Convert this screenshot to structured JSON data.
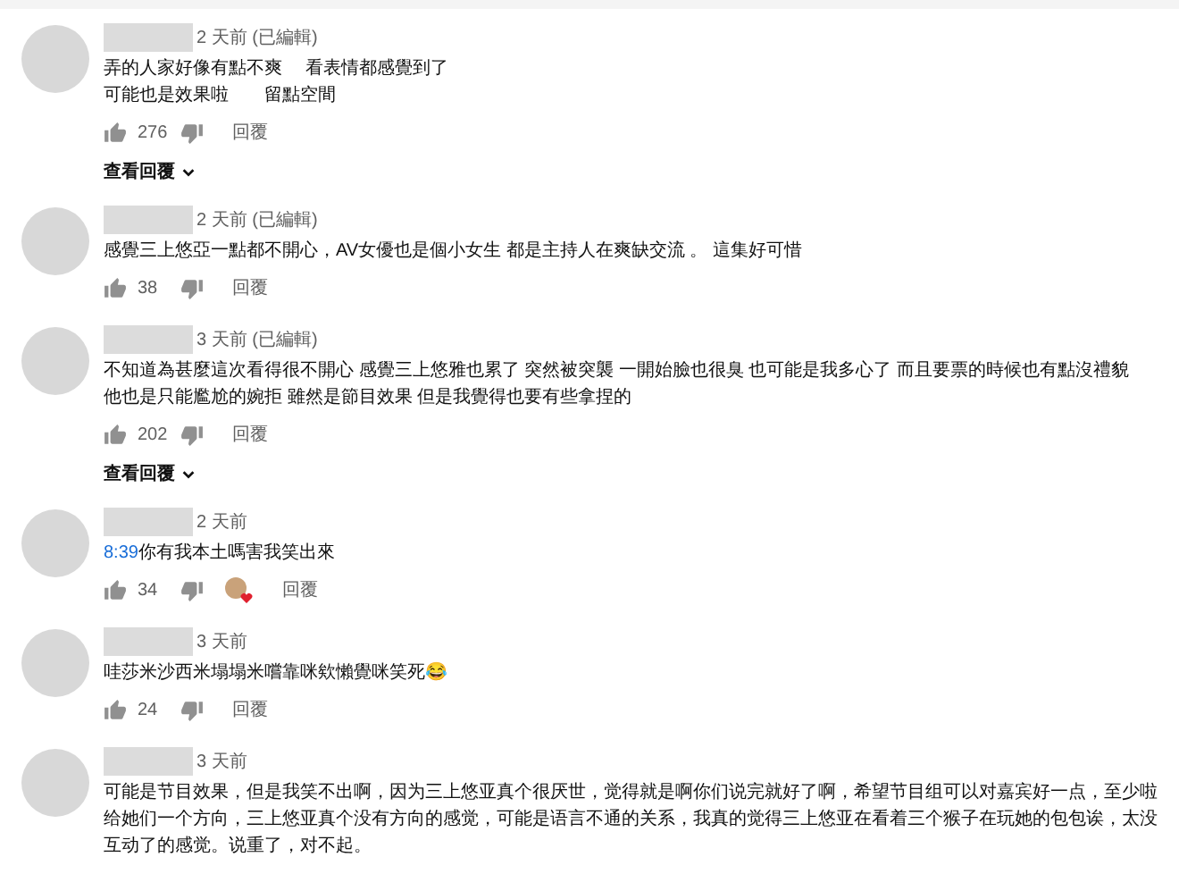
{
  "comments": [
    {
      "time": "2 天前 (已編輯)",
      "lines": [
        {
          "text": "弄的人家好像有點不爽　 看表情都感覺到了"
        },
        {
          "text": "可能也是效果啦　　留點空間"
        }
      ],
      "likes": "276",
      "hearted": false,
      "reply": "回覆",
      "view_replies": "查看回覆"
    },
    {
      "time": "2 天前 (已編輯)",
      "lines": [
        {
          "text": "感覺三上悠亞一點都不開心，AV女優也是個小女生 都是主持人在爽缺交流 。 這集好可惜"
        }
      ],
      "likes": "38",
      "hearted": false,
      "reply": "回覆"
    },
    {
      "time": "3 天前 (已編輯)",
      "lines": [
        {
          "text": "不知道為甚麼這次看得很不開心 感覺三上悠雅也累了 突然被突襲 一開始臉也很臭 也可能是我多心了 而且要票的時候也有點沒禮貌"
        },
        {
          "text": "他也是只能尷尬的婉拒 雖然是節目效果 但是我覺得也要有些拿捏的"
        }
      ],
      "likes": "202",
      "hearted": false,
      "reply": "回覆",
      "view_replies": "查看回覆"
    },
    {
      "time": "2 天前",
      "lines": [
        {
          "link": "8:39",
          "text": "你有我本土嗎害我笑出來"
        }
      ],
      "likes": "34",
      "hearted": true,
      "reply": "回覆"
    },
    {
      "time": "3 天前",
      "lines": [
        {
          "text": "哇莎米沙西米塌塌米嚐靠咪欸懶覺咪笑死😂"
        }
      ],
      "likes": "24",
      "hearted": false,
      "reply": "回覆"
    },
    {
      "time": "3 天前",
      "lines": [
        {
          "text": "可能是节目效果，但是我笑不出啊，因为三上悠亚真个很厌世，觉得就是啊你们说完就好了啊，希望节目组可以对嘉宾好一点，至少啦给她们一个方向，三上悠亚真个没有方向的感觉，可能是语言不通的关系，我真的觉得三上悠亚在看着三个猴子在玩她的包包诶，太没互动了的感觉。说重了，对不起。"
        }
      ]
    }
  ]
}
